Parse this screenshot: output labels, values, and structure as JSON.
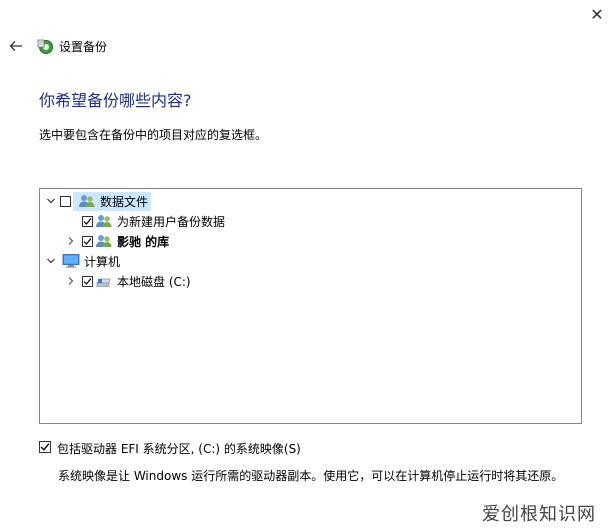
{
  "window": {
    "title": "设置备份",
    "close_glyph": "✕"
  },
  "page": {
    "heading": "你希望备份哪些内容?",
    "instruction": "选中要包含在备份中的项目对应的复选框。"
  },
  "tree": {
    "items": [
      {
        "label": "数据文件",
        "expanded": true,
        "checked": false,
        "selected": true,
        "icon": "users-group-icon"
      },
      {
        "label": "为新建用户备份数据",
        "checked": true,
        "icon": "users-group-icon"
      },
      {
        "label": "影驰 的库",
        "expanded": false,
        "checked": true,
        "icon": "users-group-icon"
      },
      {
        "label": "计算机",
        "expanded": true,
        "icon": "monitor-icon"
      },
      {
        "label": "本地磁盘 (C:)",
        "expanded": false,
        "checked": true,
        "icon": "drive-icon"
      }
    ]
  },
  "options": {
    "include_image_label": "包括驱动器 EFI 系统分区, (C:) 的系统映像(S)",
    "include_image_checked": true,
    "include_image_desc": "系统映像是让 Windows 运行所需的驱动器副本。使用它，可以在计算机停止运行时将其还原。"
  },
  "watermark": "爱创根知识网",
  "colors": {
    "heading": "#1e3287",
    "selection": "#cce8ff",
    "border": "#828790"
  }
}
